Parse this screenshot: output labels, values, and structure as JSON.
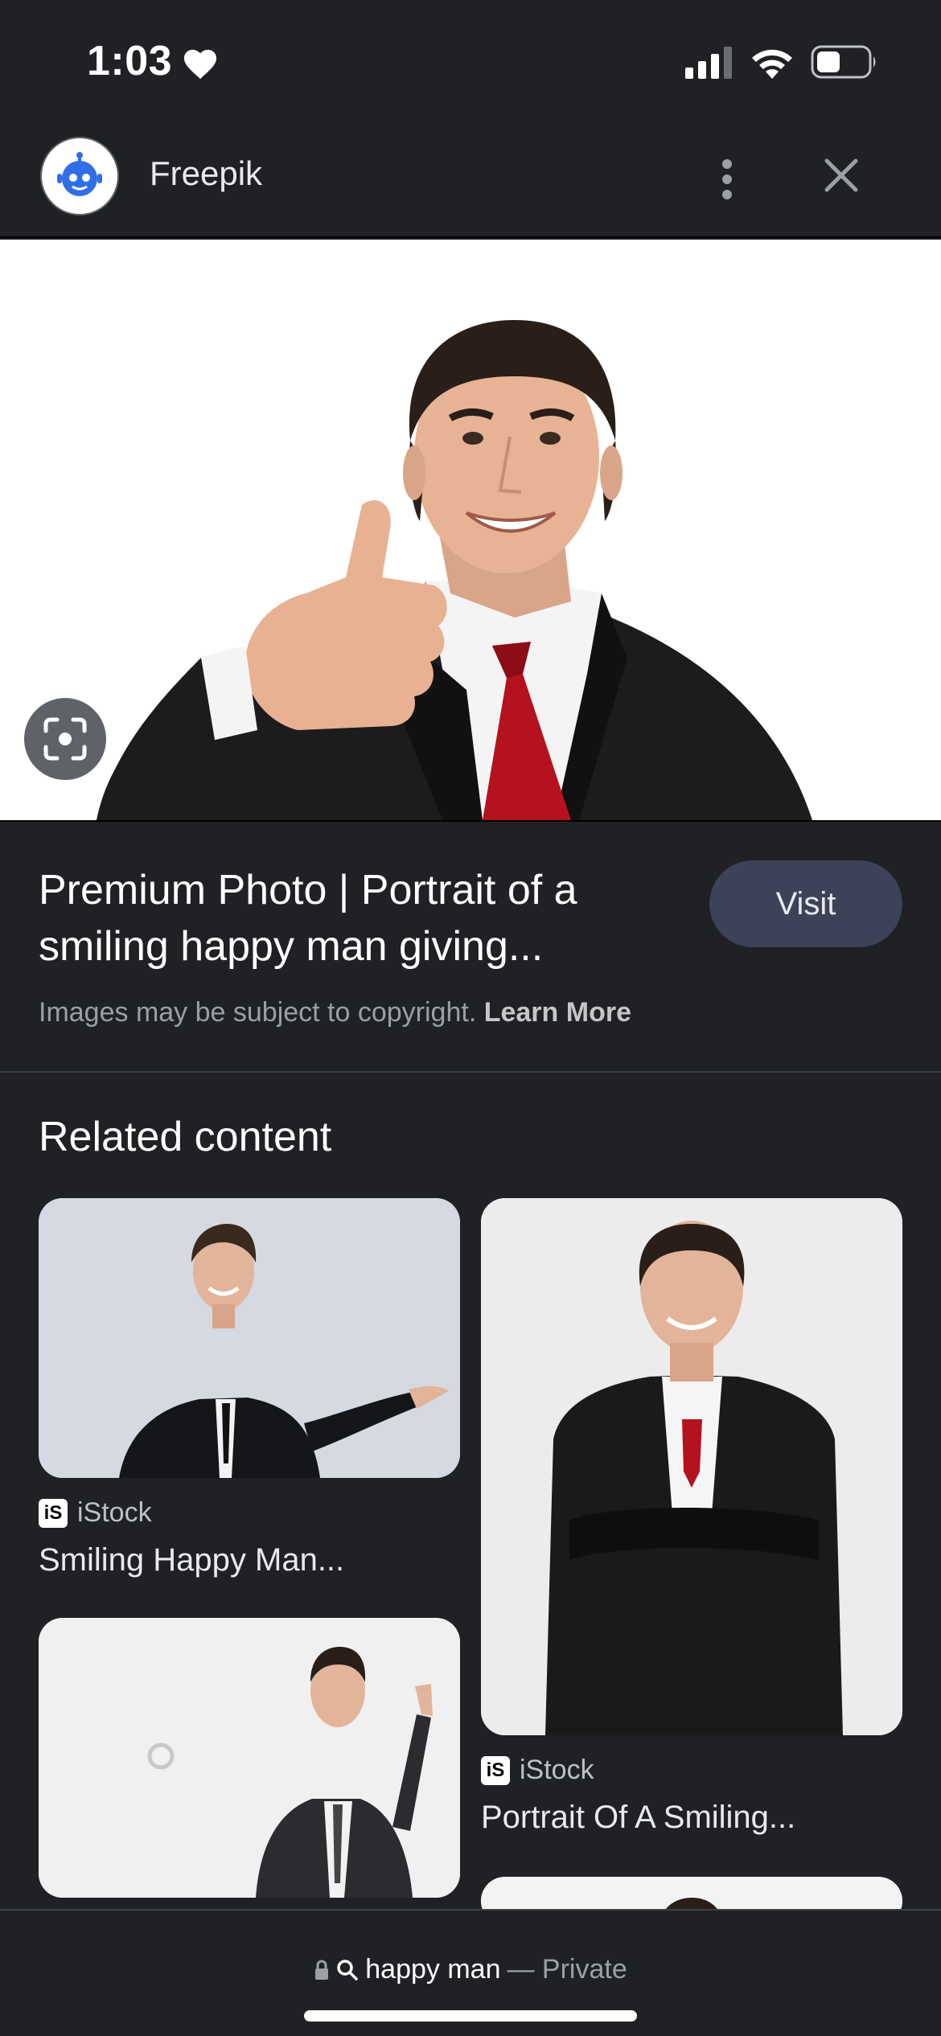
{
  "status_bar": {
    "time": "1:03"
  },
  "header": {
    "source_name": "Freepik"
  },
  "image_result": {
    "title": "Premium Photo | Portrait of a smiling happy man giving...",
    "visit_label": "Visit",
    "copyright_text": "Images may be subject to copyright.",
    "learn_more_label": "Learn More"
  },
  "related": {
    "heading": "Related content",
    "cards": [
      {
        "source": "iStock",
        "title": "Smiling Happy Man..."
      },
      {
        "source": "iStock",
        "title": "Portrait Of A Smiling..."
      }
    ]
  },
  "bottom_bar": {
    "query": "happy man",
    "mode": "— Private"
  },
  "colors": {
    "background": "#202124",
    "visit_button": "#3c4257",
    "tie_red": "#b3121e"
  },
  "icons": [
    "heart-icon",
    "signal-icon",
    "wifi-icon",
    "battery-icon",
    "more-vert-icon",
    "close-icon",
    "lens-icon",
    "lock-icon",
    "search-icon"
  ]
}
